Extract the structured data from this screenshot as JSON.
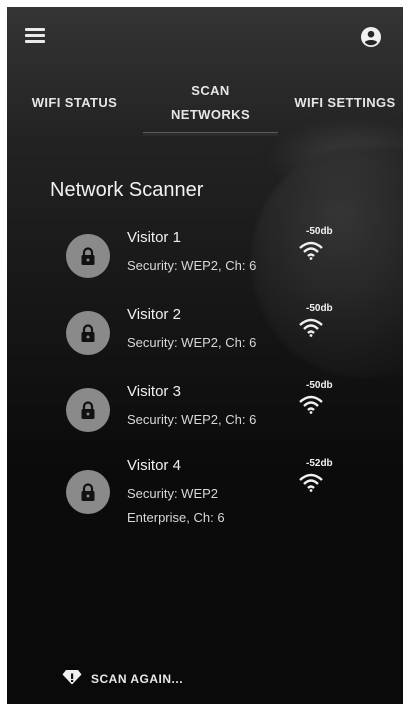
{
  "header": {
    "menu_icon": "hamburger-menu-icon",
    "account_icon": "account-circle-icon"
  },
  "tabs": [
    {
      "label": "WIFI STATUS"
    },
    {
      "label_line1": "SCAN",
      "label_line2": "NETWORKS",
      "active": true
    },
    {
      "label": "WIFI SETTINGS"
    }
  ],
  "main": {
    "title": "Network Scanner",
    "networks": [
      {
        "name": "Visitor 1",
        "security": "Security: WEP2, Ch: 6",
        "signal": "-50db",
        "icon": "lock-icon"
      },
      {
        "name": "Visitor 2",
        "security": "Security: WEP2, Ch: 6",
        "signal": "-50db",
        "icon": "lock-icon"
      },
      {
        "name": "Visitor 3",
        "security": "Security: WEP2, Ch: 6",
        "signal": "-50db",
        "icon": "lock-icon"
      },
      {
        "name": "Visitor 4",
        "security_line1": "Security: WEP2",
        "security_line2": "Enterprise, Ch: 6",
        "signal": "-52db",
        "icon": "lock-icon"
      }
    ]
  },
  "footer": {
    "scan_again_label": "SCAN AGAIN...",
    "scan_icon": "diamond-info-icon"
  }
}
